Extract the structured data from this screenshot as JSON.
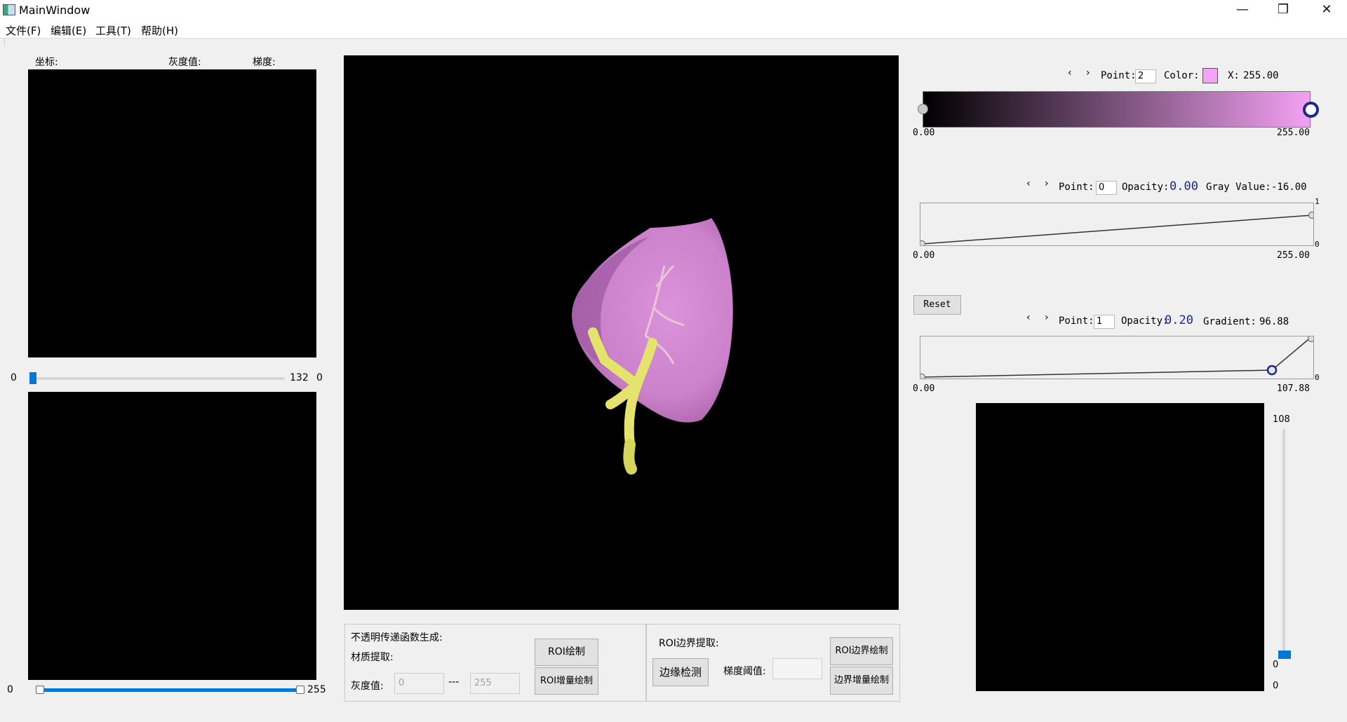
{
  "window": {
    "title": "MainWindow",
    "minimize_icon": "minimize-icon",
    "maximize_icon": "restore-icon",
    "close_icon": "close-icon"
  },
  "menu": {
    "items": [
      "文件(F)",
      "编辑(E)",
      "工具(T)",
      "帮助(H)"
    ]
  },
  "left_panel": {
    "coord_label": "坐标:",
    "gray_label": "灰度值:",
    "gradient_label": "梯度:",
    "slice_slider": {
      "min": "0",
      "value": "132",
      "max": "0",
      "fraction": 0.0
    },
    "range_slider": {
      "min": "0",
      "max": "255",
      "low_fraction": 0.0,
      "high_fraction": 1.0
    }
  },
  "bottom_group_left": {
    "title": "不透明传递函数生成:",
    "material_label": "材质提取:",
    "gray_label": "灰度值:",
    "low_value": "0",
    "separator": "---",
    "high_value": "255",
    "roi_draw_button": "ROI绘制",
    "roi_increment_button": "ROI增量绘制"
  },
  "bottom_group_right": {
    "title": "ROI边界提取:",
    "edge_detect_button": "边缘检测",
    "gradient_threshold_label": "梯度阈值:",
    "gradient_threshold_value": "",
    "roi_edge_draw_button": "ROI边界绘制",
    "edge_increment_button": "边界增量绘制"
  },
  "color_tf": {
    "nav": "‹ ›",
    "point_label": "Point:",
    "point_value": "2",
    "color_label": "Color:",
    "color_swatch": "#f4a4f4",
    "x_label": "X:",
    "x_value": "255.00",
    "min_label": "0.00",
    "max_label": "255.00",
    "gradient_start": "#000000",
    "gradient_end": "#f3a1f3"
  },
  "opacity_tf": {
    "nav": "‹ ›",
    "point_label": "Point:",
    "point_value": "0",
    "opacity_label": "Opacity:",
    "opacity_value": "0.00",
    "gray_label": "Gray Value:",
    "gray_value": "-16.00",
    "y_top": "1",
    "y_bottom": "0",
    "min_label": "0.00",
    "max_label": "255.00"
  },
  "reset_button": "Reset",
  "gradient_tf": {
    "nav": "‹ ›",
    "point_label": "Point:",
    "point_value": "1",
    "opacity_label": "Opacity:",
    "opacity_value": "0.20",
    "gradient_label": "Gradient:",
    "gradient_value": "96.88",
    "y_bottom": "0",
    "min_label": "0.00",
    "max_label": "107.88"
  },
  "right_slider": {
    "top_label": "108",
    "value_label": "0",
    "bottom_label": "0",
    "fraction": 0.0
  }
}
